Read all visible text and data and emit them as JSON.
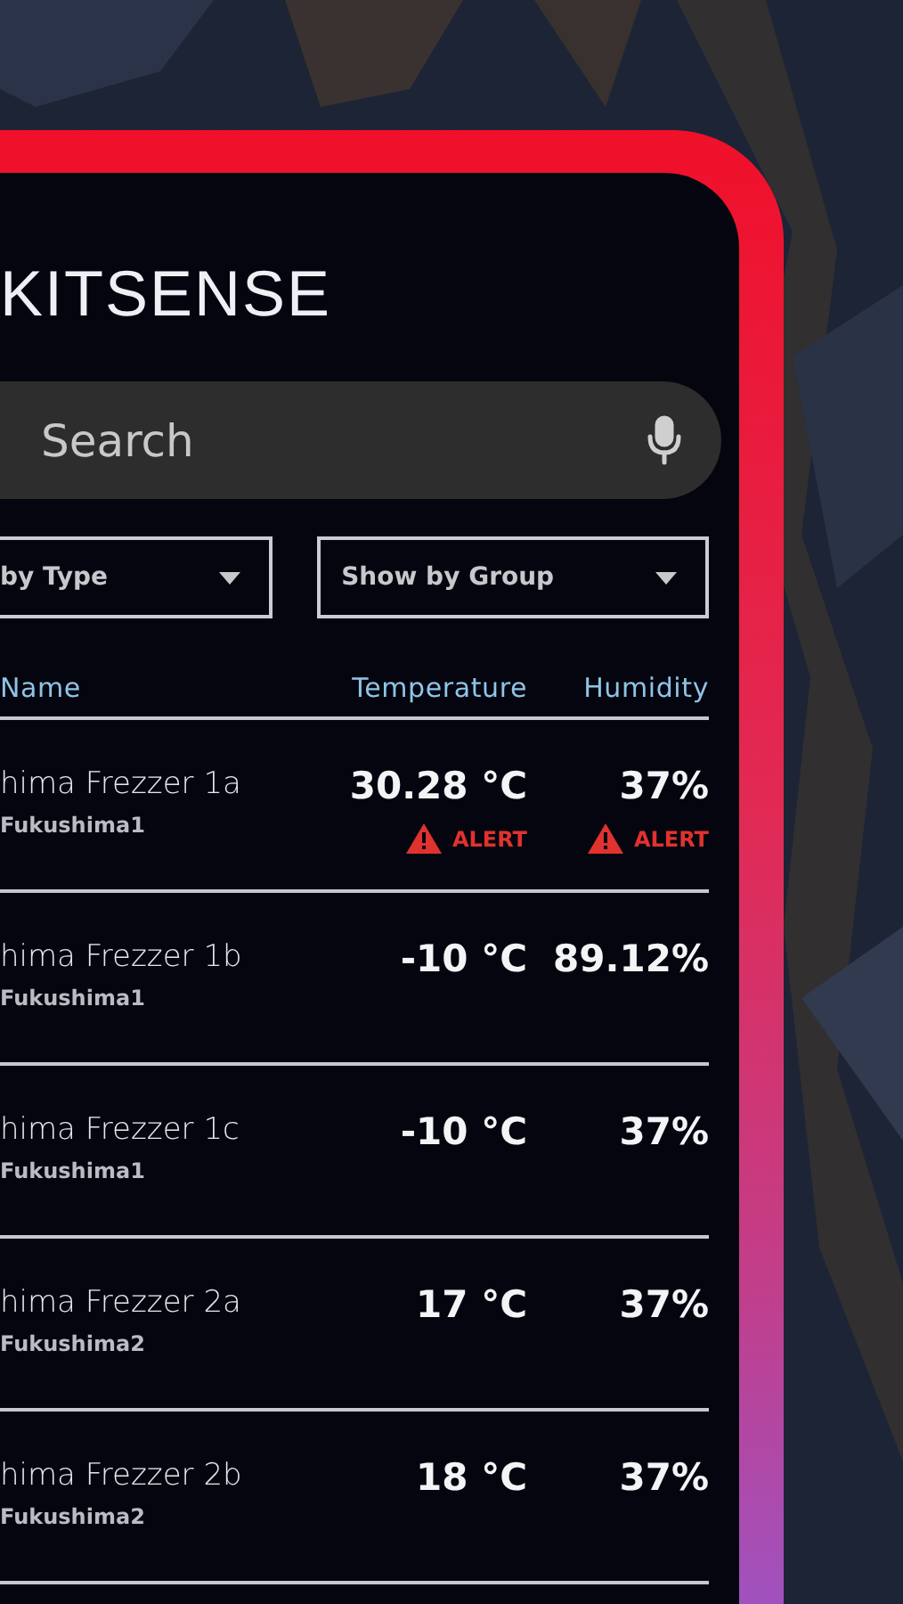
{
  "app": {
    "title": "KITSENSE"
  },
  "search": {
    "placeholder": "Search"
  },
  "filters": [
    {
      "label": "by Type"
    },
    {
      "label": "Show by Group"
    }
  ],
  "table": {
    "columns": [
      "Name",
      "Temperature",
      "Humidity"
    ],
    "rows": [
      {
        "name": "hima Frezzer 1a",
        "group": "Fukushima1",
        "temperature": "30.28 °C",
        "temperature_alert": "ALERT",
        "humidity": "37%",
        "humidity_alert": "ALERT"
      },
      {
        "name": "hima Frezzer 1b",
        "group": "Fukushima1",
        "temperature": "-10 °C",
        "humidity": "89.12%"
      },
      {
        "name": "hima Frezzer 1c",
        "group": "Fukushima1",
        "temperature": "-10 °C",
        "humidity": "37%"
      },
      {
        "name": "hima Frezzer 2a",
        "group": "Fukushima2",
        "temperature": "17 °C",
        "humidity": "37%"
      },
      {
        "name": "hima Frezzer 2b",
        "group": "Fukushima2",
        "temperature": "18 °C",
        "humidity": "37%"
      }
    ]
  }
}
